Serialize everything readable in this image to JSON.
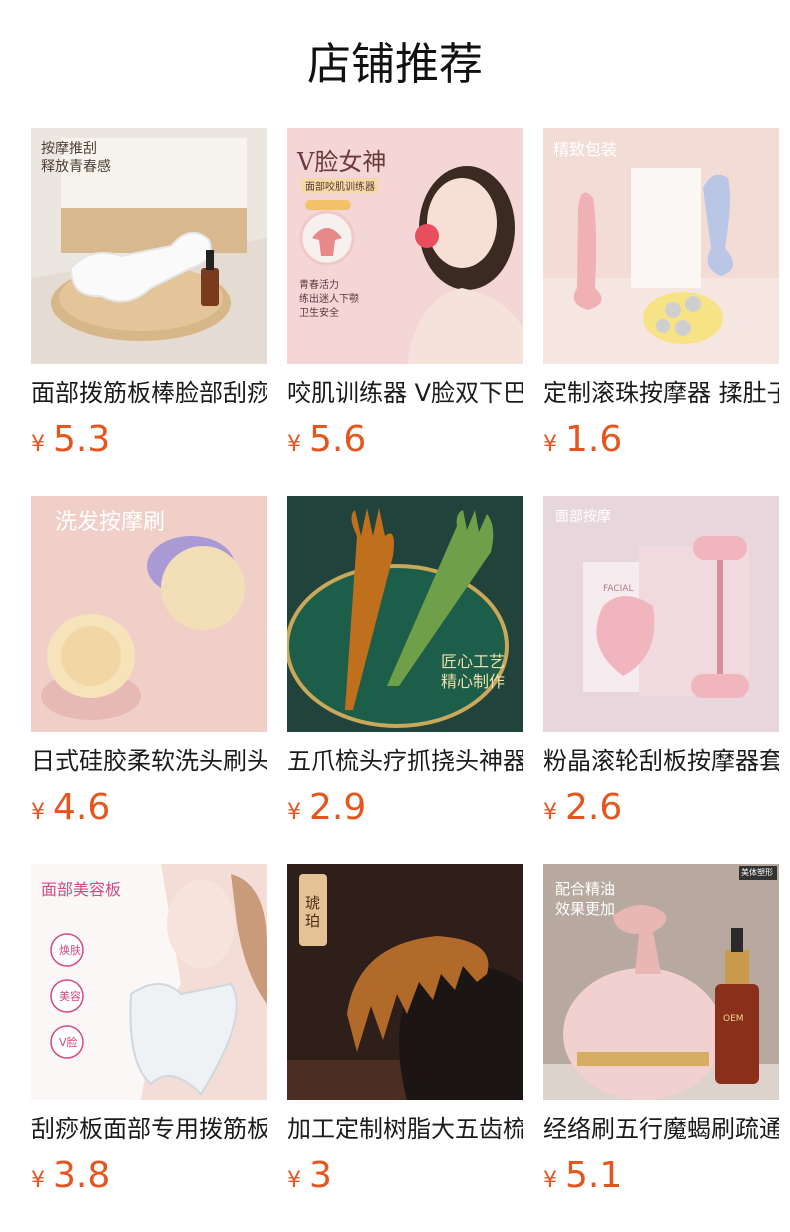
{
  "header": {
    "title": "店铺推荐"
  },
  "products": [
    {
      "title": "面部拨筋板棒脸部刮痧",
      "currency": "¥",
      "price": "5.3",
      "thumb_text": [
        "按摩推刮",
        "释放青春感"
      ]
    },
    {
      "title": "咬肌训练器 V脸双下巴",
      "currency": "¥",
      "price": "5.6",
      "thumb_text": [
        "V脸女神",
        "面部咬肌训练器",
        "青春活力",
        "练出迷人下颚",
        "卫生安全"
      ]
    },
    {
      "title": "定制滚珠按摩器 揉肚子",
      "currency": "¥",
      "price": "1.6",
      "thumb_text": [
        "精致包装"
      ]
    },
    {
      "title": "日式硅胶柔软洗头刷头皮",
      "currency": "¥",
      "price": "4.6",
      "thumb_text": [
        "洗发按摩刷"
      ]
    },
    {
      "title": "五爪梳头疗抓挠头神器",
      "currency": "¥",
      "price": "2.9",
      "thumb_text": [
        "匠心工艺",
        "精心制作"
      ]
    },
    {
      "title": "粉晶滚轮刮板按摩器套装",
      "currency": "¥",
      "price": "2.6",
      "thumb_text": [
        "面部按摩",
        "FACIAL"
      ]
    },
    {
      "title": "刮痧板面部专用拨筋板",
      "currency": "¥",
      "price": "3.8",
      "thumb_text": [
        "面部美容板",
        "焕肤",
        "美容",
        "V脸"
      ]
    },
    {
      "title": "加工定制树脂大五齿梳",
      "currency": "¥",
      "price": "3",
      "thumb_text": [
        "琥珀"
      ]
    },
    {
      "title": "经络刷五行魔蝎刷疏通",
      "currency": "¥",
      "price": "5.1",
      "thumb_text": [
        "配合精油",
        "效果更加",
        "美体塑形",
        "OEM"
      ]
    }
  ],
  "colors": {
    "price": "#e8541d",
    "title": "#1b1b1b"
  }
}
